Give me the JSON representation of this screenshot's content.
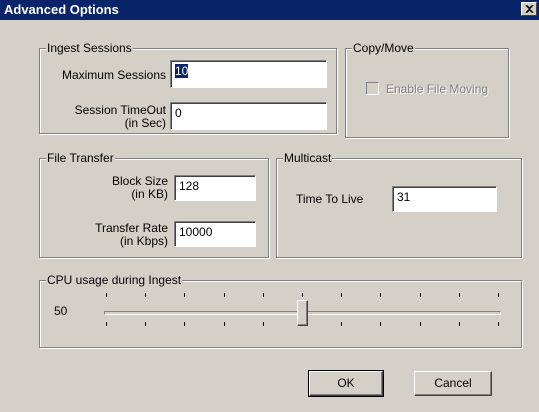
{
  "window": {
    "title": "Advanced Options",
    "close_glyph": "×"
  },
  "ingest_sessions": {
    "label": "Ingest Sessions",
    "max_sessions_label": "Maximum Sessions",
    "max_sessions_value": "10",
    "timeout_label_1": "Session TimeOut",
    "timeout_label_2": "(in Sec)",
    "timeout_value": "0"
  },
  "copy_move": {
    "label": "Copy/Move",
    "enable_file_moving_label": "Enable File Moving",
    "enable_file_moving_checked": false
  },
  "file_transfer": {
    "label": "File Transfer",
    "block_size_label_1": "Block Size",
    "block_size_label_2": "(in KB)",
    "block_size_value": "128",
    "transfer_rate_label_1": "Transfer Rate",
    "transfer_rate_label_2": "(in Kbps)",
    "transfer_rate_value": "10000"
  },
  "multicast": {
    "label": "Multicast",
    "ttl_label": "Time To Live",
    "ttl_value": "31"
  },
  "cpu_usage": {
    "label": "CPU usage during Ingest",
    "value_text": "50",
    "min": 0,
    "max": 100,
    "value": 50
  },
  "buttons": {
    "ok": "OK",
    "cancel": "Cancel"
  },
  "colors": {
    "titlebar": "#0a246a",
    "face": "#d4d0c8"
  }
}
